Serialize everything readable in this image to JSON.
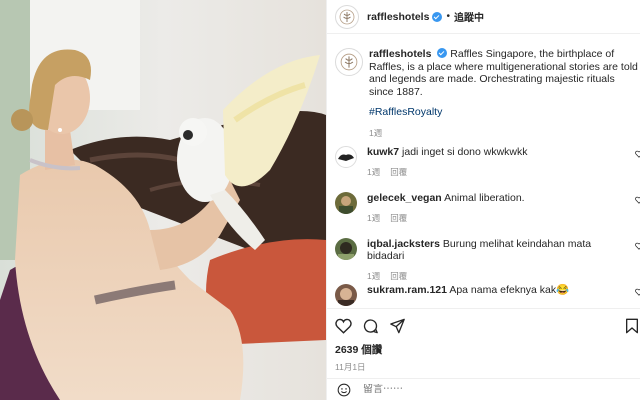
{
  "post": {
    "username": "raffleshotels",
    "follow_label": "追蹤中",
    "caption_text": "Raffles Singapore, the birthplace of Raffles, is a place where multigenerational stories are told and legends are made. Orchestrating majestic rituals since 1887.",
    "hashtag": "#RafflesRoyalty",
    "caption_time": "1週"
  },
  "comments": [
    {
      "username": "kuwk7",
      "text": "jadi inget si dono wkwkwkk",
      "time": "1週",
      "reply": "回覆"
    },
    {
      "username": "gelecek_vegan",
      "text": "Animal liberation.",
      "time": "1週",
      "reply": "回覆"
    },
    {
      "username": "iqbal.jacksters",
      "text": "Burung melihat keindahan mata bidadari",
      "time": "1週",
      "reply": "回覆"
    },
    {
      "username": "sukram.ram.121",
      "text": "Apa nama efeknya kak😂"
    }
  ],
  "stats": {
    "likes": "2639 個讚",
    "date": "11月1日"
  },
  "add_comment": {
    "placeholder": "留言⋯⋯"
  },
  "colors": {
    "verified": "#3897f0",
    "hashtag": "#00376b",
    "muted": "#8e8e8e"
  }
}
